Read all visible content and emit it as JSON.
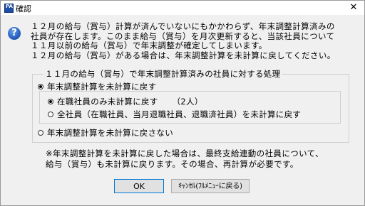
{
  "window": {
    "title": "確認",
    "app_icon_text": "PA",
    "close_glyph": "✕"
  },
  "dialog": {
    "icon": "question-icon",
    "message_lines": [
      "１２月の給与（賞与）計算が済んでいないにもかかわらず、年末調整計算済みの",
      "社員が存在します。このまま給与（賞与）を月次更新すると、当該社員について",
      "１１月以前の給与（賞与）で年末調整が確定してしまいます。",
      "１２月の給与（賞与）がある場合は、年末調整計算を未計算に戻してください。"
    ],
    "group_label": "１１月の給与（賞与）で年末調整計算済みの社員に対する処理",
    "options": {
      "revert": {
        "label": "年末調整計算を未計算に戻す",
        "selected": true
      },
      "active_only": {
        "label": "在職社員のみ未計算に戻す",
        "count": "（2人）",
        "selected": true
      },
      "all_employees": {
        "label": "全社員（在職社員、当月退職社員、退職済社員）を未計算に戻す",
        "selected": false
      },
      "no_revert": {
        "label": "年末調整計算を未計算に戻さない",
        "selected": false
      }
    },
    "note_lines": [
      "※年末調整計算を未計算に戻した場合は、最終支給連動の社員について、",
      "給与（賞与）も未計算に戻ります。その場合、再計算が必要です。"
    ],
    "buttons": {
      "ok": "OK",
      "cancel": "ｷｬﾝｾﾙ(ﾌﾙﾒﾆｭｰに戻る)"
    }
  }
}
